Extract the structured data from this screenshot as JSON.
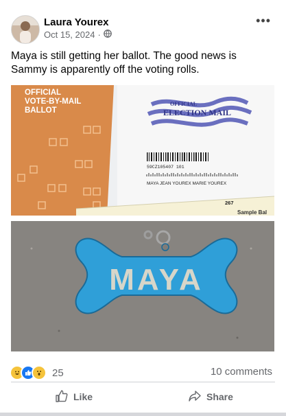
{
  "post": {
    "author": "Laura Yourex",
    "date": "Oct 15, 2024",
    "separator": "·",
    "text": "Maya is still getting her ballot.  The good news is Sammy is apparently off the voting rolls."
  },
  "icons": {
    "privacy": "globe-icon",
    "more": "more-options-icon",
    "like": "thumbs-up-icon",
    "share": "share-arrow-icon"
  },
  "image1": {
    "ballot_label_lines": [
      "OFFICIAL",
      "VOTE-BY-MAIL",
      "BALLOT"
    ],
    "envelope_logo_line1": "OFFICIAL",
    "envelope_logo_line2": "ELECTION MAIL",
    "barcode_number": "59CZ105407  101",
    "addressee": "MAYA JEAN YOUREX MARIE YOUREX",
    "card_number": "267",
    "card_label": "Sample Bal"
  },
  "image2": {
    "tag_name": "MAYA"
  },
  "footer": {
    "reaction_count": "25",
    "comments": "10 comments",
    "like_label": "Like",
    "share_label": "Share"
  },
  "colors": {
    "orange": "#d98a4a",
    "tag_blue": "#2f9fd8",
    "meta_grey": "#65676b"
  }
}
